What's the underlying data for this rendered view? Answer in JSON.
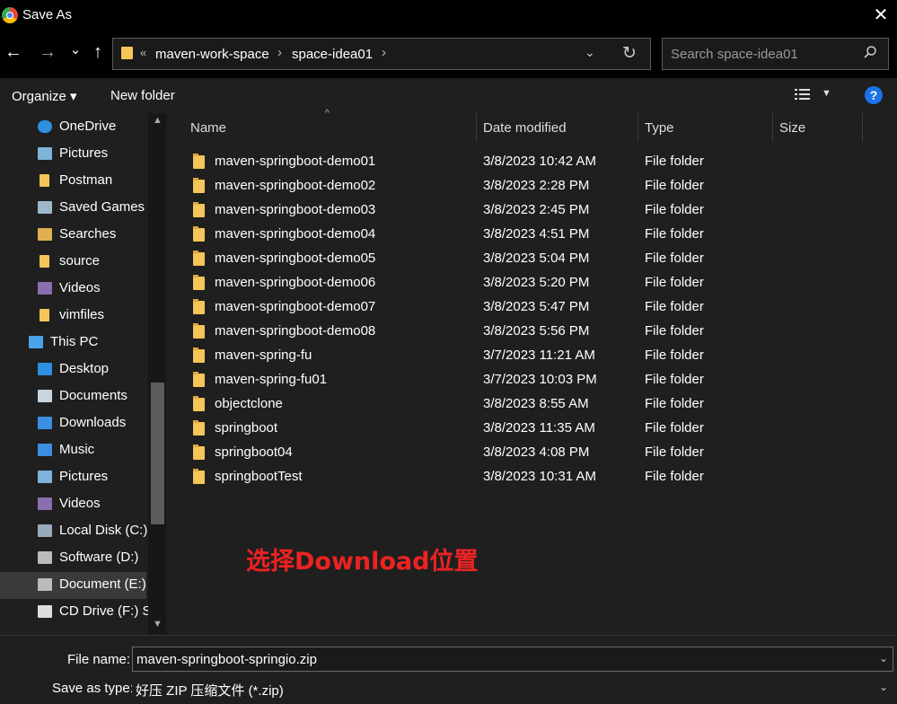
{
  "window": {
    "title": "Save As",
    "close_glyph": "✕"
  },
  "nav": {
    "back_glyph": "←",
    "forward_glyph": "→",
    "recent_glyph": "⌄",
    "up_glyph": "↑",
    "breadcrumb_prefix": "«",
    "breadcrumbs": [
      "maven-work-space",
      "space-idea01"
    ],
    "separator": "›",
    "dropdown_glyph": "⌄",
    "refresh_glyph": "↻",
    "search_placeholder": "Search space-idea01"
  },
  "toolbar": {
    "organize": "Organize ▾",
    "new_folder": "New folder",
    "help": "?"
  },
  "sidebar": {
    "items": [
      {
        "label": "OneDrive",
        "icon": "cloud-icon",
        "indent": 2
      },
      {
        "label": "Pictures",
        "icon": "pictures-icon",
        "indent": 2
      },
      {
        "label": "Postman",
        "icon": "folder-icon",
        "indent": 2
      },
      {
        "label": "Saved Games",
        "icon": "saved-games-icon",
        "indent": 2
      },
      {
        "label": "Searches",
        "icon": "searches-icon",
        "indent": 2
      },
      {
        "label": "source",
        "icon": "folder-icon",
        "indent": 2
      },
      {
        "label": "Videos",
        "icon": "videos-icon",
        "indent": 2
      },
      {
        "label": "vimfiles",
        "icon": "folder-icon",
        "indent": 2
      },
      {
        "label": "This PC",
        "icon": "computer-icon",
        "indent": 1
      },
      {
        "label": "Desktop",
        "icon": "desktop-icon",
        "indent": 2
      },
      {
        "label": "Documents",
        "icon": "documents-icon",
        "indent": 2
      },
      {
        "label": "Downloads",
        "icon": "downloads-icon",
        "indent": 2
      },
      {
        "label": "Music",
        "icon": "music-icon",
        "indent": 2
      },
      {
        "label": "Pictures",
        "icon": "pictures-icon",
        "indent": 2
      },
      {
        "label": "Videos",
        "icon": "videos-icon",
        "indent": 2
      },
      {
        "label": "Local Disk (C:)",
        "icon": "windows-drive-icon",
        "indent": 2
      },
      {
        "label": "Software (D:)",
        "icon": "drive-icon",
        "indent": 2
      },
      {
        "label": "Document (E:)",
        "icon": "drive-icon",
        "indent": 2,
        "selected": true
      },
      {
        "label": "CD Drive (F:) SF",
        "icon": "cd-drive-icon",
        "indent": 2
      }
    ],
    "scroll_up": "▲",
    "scroll_down": "▼"
  },
  "columns": {
    "name": "Name",
    "date": "Date modified",
    "type": "Type",
    "size": "Size",
    "sort_glyph": "^"
  },
  "files": [
    {
      "name": "maven-springboot-demo01",
      "date": "3/8/2023 10:42 AM",
      "type": "File folder"
    },
    {
      "name": "maven-springboot-demo02",
      "date": "3/8/2023 2:28 PM",
      "type": "File folder"
    },
    {
      "name": "maven-springboot-demo03",
      "date": "3/8/2023 2:45 PM",
      "type": "File folder"
    },
    {
      "name": "maven-springboot-demo04",
      "date": "3/8/2023 4:51 PM",
      "type": "File folder"
    },
    {
      "name": "maven-springboot-demo05",
      "date": "3/8/2023 5:04 PM",
      "type": "File folder"
    },
    {
      "name": "maven-springboot-demo06",
      "date": "3/8/2023 5:20 PM",
      "type": "File folder"
    },
    {
      "name": "maven-springboot-demo07",
      "date": "3/8/2023 5:47 PM",
      "type": "File folder"
    },
    {
      "name": "maven-springboot-demo08",
      "date": "3/8/2023 5:56 PM",
      "type": "File folder"
    },
    {
      "name": "maven-spring-fu",
      "date": "3/7/2023 11:21 AM",
      "type": "File folder"
    },
    {
      "name": "maven-spring-fu01",
      "date": "3/7/2023 10:03 PM",
      "type": "File folder"
    },
    {
      "name": "objectclone",
      "date": "3/8/2023 8:55 AM",
      "type": "File folder"
    },
    {
      "name": "springboot",
      "date": "3/8/2023 11:35 AM",
      "type": "File folder"
    },
    {
      "name": "springboot04",
      "date": "3/8/2023 4:08 PM",
      "type": "File folder"
    },
    {
      "name": "springbootTest",
      "date": "3/8/2023 10:31 AM",
      "type": "File folder"
    }
  ],
  "annotation": "选择Download位置",
  "footer": {
    "file_name_label": "File name:",
    "file_name_value": "maven-springboot-springio.zip",
    "save_as_type_label": "Save as type:",
    "save_as_type_value": "好压 ZIP 压缩文件 (*.zip)",
    "dropdown_glyph": "⌄"
  },
  "colors": {
    "accent": "#1a73e8",
    "folder": "#f4c557",
    "annotation": "#ee2222",
    "background": "#1f1f1f"
  }
}
